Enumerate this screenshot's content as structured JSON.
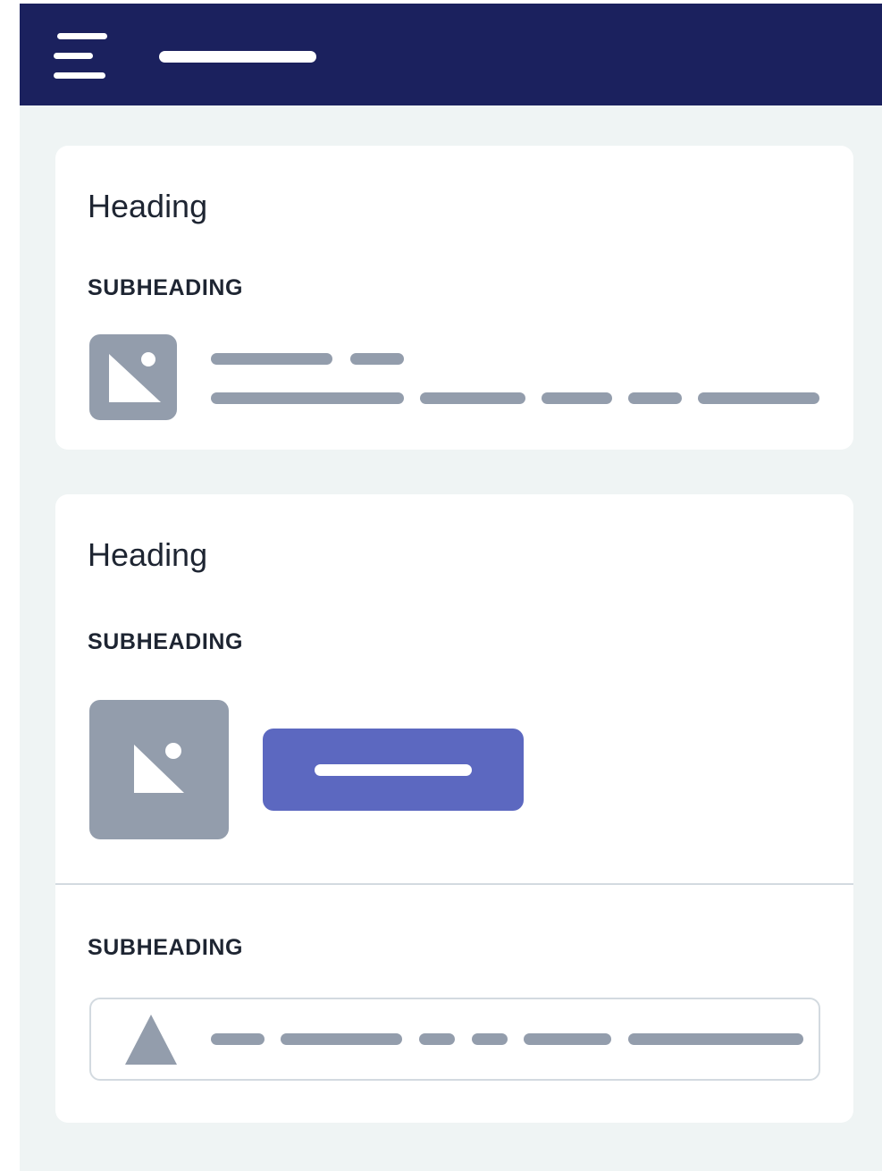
{
  "header": {
    "menu_icon": "hamburger-menu-icon",
    "background": "#1b215e"
  },
  "cards": [
    {
      "heading": "Heading",
      "subheading": "SUBHEADING",
      "image_icon": "image-placeholder-icon"
    },
    {
      "heading": "Heading",
      "subheading": "SUBHEADING",
      "image_icon": "image-placeholder-icon",
      "button_color": "#5c68c0",
      "section2_subheading": "SUBHEADING",
      "field_icon": "triangle-icon"
    }
  ],
  "colors": {
    "page_background": "#eff4f4",
    "card_background": "#ffffff",
    "placeholder_gray": "#939dac",
    "text": "#1e2532",
    "border": "#d3dae0"
  }
}
